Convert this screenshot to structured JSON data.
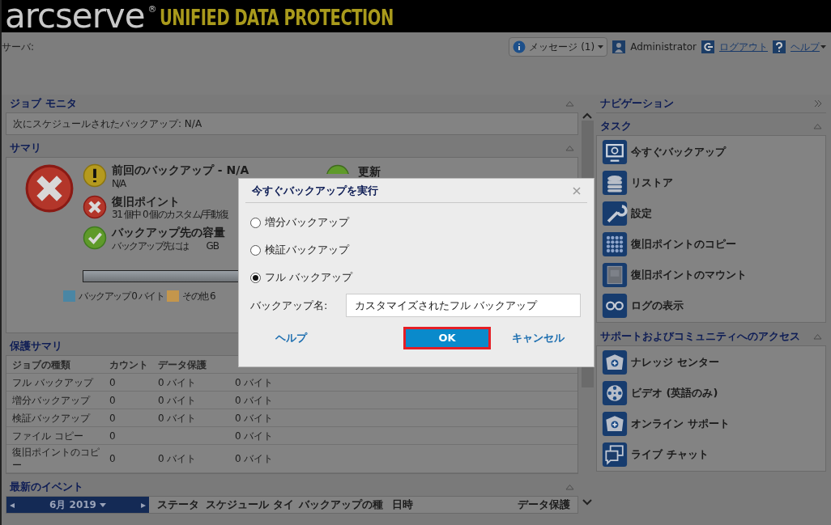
{
  "header": {
    "brand": "arcserve",
    "registered": "®",
    "product": "UNIFIED DATA PROTECTION"
  },
  "topbar": {
    "server_label": "サーバ:",
    "messages_button": "メッセージ (1)",
    "user": "Administrator",
    "logout": "ログアウト",
    "help": "ヘルプ"
  },
  "job_monitor": {
    "title": "ジョブ モニタ",
    "next_scheduled": "次にスケジュールされたバックアップ: N/A"
  },
  "summary": {
    "title": "サマリ",
    "overall": {
      "kind": "error"
    },
    "items": [
      {
        "kind": "warning",
        "title": "前回のバックアップ - N/A",
        "detail": "N/A"
      },
      {
        "kind": "error",
        "title": "復旧ポイント",
        "detail": "31 個中 0 個のカスタム/手動復"
      },
      {
        "kind": "ok",
        "title": "バックアップ先の容量",
        "detail": "バックアップ先には",
        "detail_2": "GB"
      }
    ],
    "update": {
      "kind": "ok",
      "title": "更新"
    },
    "legend": [
      {
        "label": "バックアップ 0 バイト",
        "color": "#4a86a4"
      },
      {
        "label": "その他 6",
        "color": "#c4964c"
      }
    ]
  },
  "protection_summary": {
    "title": "保護サマリ",
    "columns": [
      "ジョブの種類",
      "カウント",
      "データ保護"
    ],
    "rows": [
      [
        "フル バックアップ",
        "0",
        "0 バイト",
        "0 バイト"
      ],
      [
        "増分バックアップ",
        "0",
        "0 バイト",
        "0 バイト"
      ],
      [
        "検証バックアップ",
        "0",
        "0 バイト",
        "0 バイト"
      ],
      [
        "ファイル コピー",
        "0",
        "",
        "0 バイト"
      ],
      [
        "復旧ポイントのコピー",
        "0",
        "0 バイト",
        "0 バイト"
      ]
    ]
  },
  "recent_events": {
    "title": "最新のイベント",
    "month": "6月 2019",
    "prev": "◂",
    "next": "▸",
    "columns": [
      "ステータ",
      "スケジュール タイ",
      "バックアップの種",
      "日時",
      "データ保護"
    ]
  },
  "navigation": {
    "title": "ナビゲーション",
    "tasks_title": "タスク",
    "tasks": [
      {
        "kind": "monitor",
        "label": "今すぐバックアップ"
      },
      {
        "kind": "database",
        "label": "リストア"
      },
      {
        "kind": "wrench",
        "label": "設定"
      },
      {
        "kind": "grid",
        "label": "復旧ポイントのコピー"
      },
      {
        "kind": "drive",
        "label": "復旧ポイントのマウント"
      },
      {
        "kind": "glasses",
        "label": "ログの表示"
      }
    ],
    "support_title": "サポートおよびコミュニティへのアクセス",
    "support": [
      {
        "kind": "medkit",
        "label": "ナレッジ センター"
      },
      {
        "kind": "film",
        "label": "ビデオ (英語のみ)"
      },
      {
        "kind": "medkit",
        "label": "オンライン サポート"
      },
      {
        "kind": "chat",
        "label": "ライブ チャット"
      }
    ]
  },
  "dialog": {
    "title": "今すぐバックアップを実行",
    "options": [
      {
        "label": "増分バックアップ",
        "selected": false
      },
      {
        "label": "検証バックアップ",
        "selected": false
      },
      {
        "label": "フル バックアップ",
        "selected": true
      }
    ],
    "name_label": "バックアップ名:",
    "name_value": "カスタマイズされたフル バックアップ",
    "help": "ヘルプ",
    "ok": "OK",
    "ok_highlighted": true,
    "cancel": "キャンセル"
  }
}
